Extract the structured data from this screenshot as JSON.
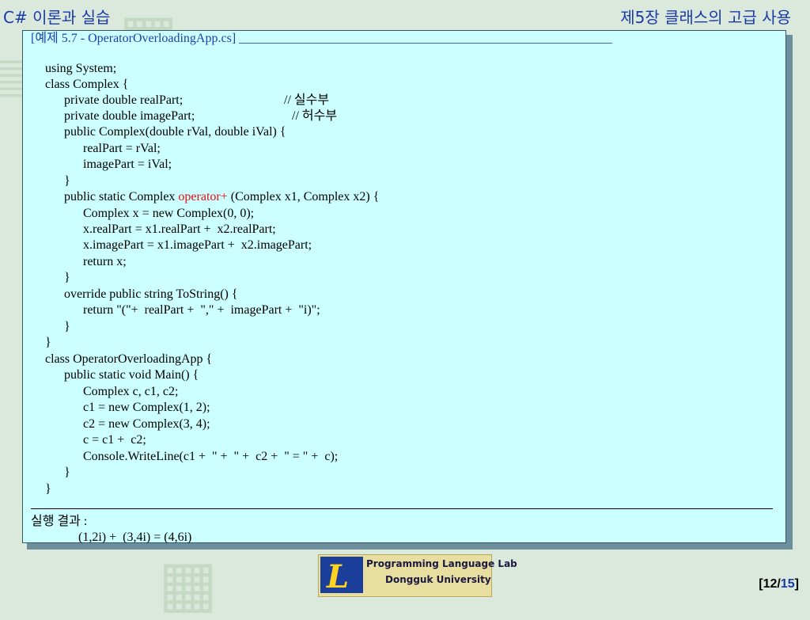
{
  "header": {
    "course": "C# 이론과 실습",
    "chapter": "제5장 클래스의 고급 사용"
  },
  "example": {
    "title": "[예제 5.7 - OperatorOverloadingApp.cs] ___________________________________________________________",
    "code_lines": [
      "using System;",
      "class Complex {",
      "private double realPart;",
      "// 실수부",
      "private double imagePart;",
      "// 허수부",
      "public Complex(double rVal, double iVal) {",
      "realPart = rVal;",
      "imagePart = iVal;",
      "}",
      "public static Complex ",
      "operator+",
      " (Complex x1, Complex x2) {",
      "Complex x = new Complex(0, 0);",
      "x.realPart = x1.realPart +  x2.realPart;",
      "x.imagePart = x1.imagePart +  x2.imagePart;",
      "return x;",
      "}",
      "override public string ToString() {",
      "return \"(\"+  realPart +  \",\" +  imagePart +  \"i)\";",
      "}",
      "}",
      "class OperatorOverloadingApp {",
      "public static void Main() {",
      "Complex c, c1, c2;",
      "c1 = new Complex(1, 2);",
      "c2 = new Complex(3, 4);",
      "c = c1 +  c2;",
      "Console.WriteLine(c1 +  \" +  \" +  c2 +  \" = \" +  c);",
      "}",
      "}"
    ],
    "result_label": "실행 결과 :",
    "result_value": "(1,2i) +  (3,4i) = (4,6i)"
  },
  "logo": {
    "mark": "L",
    "line1": "Programming Language Lab",
    "line2": "Dongguk University"
  },
  "page": {
    "current": "12",
    "separator": "/",
    "total": "15"
  },
  "colors": {
    "panel_bg": "#ccffff",
    "header_text": "#1a3aaa",
    "keyword_red": "#e01010"
  }
}
